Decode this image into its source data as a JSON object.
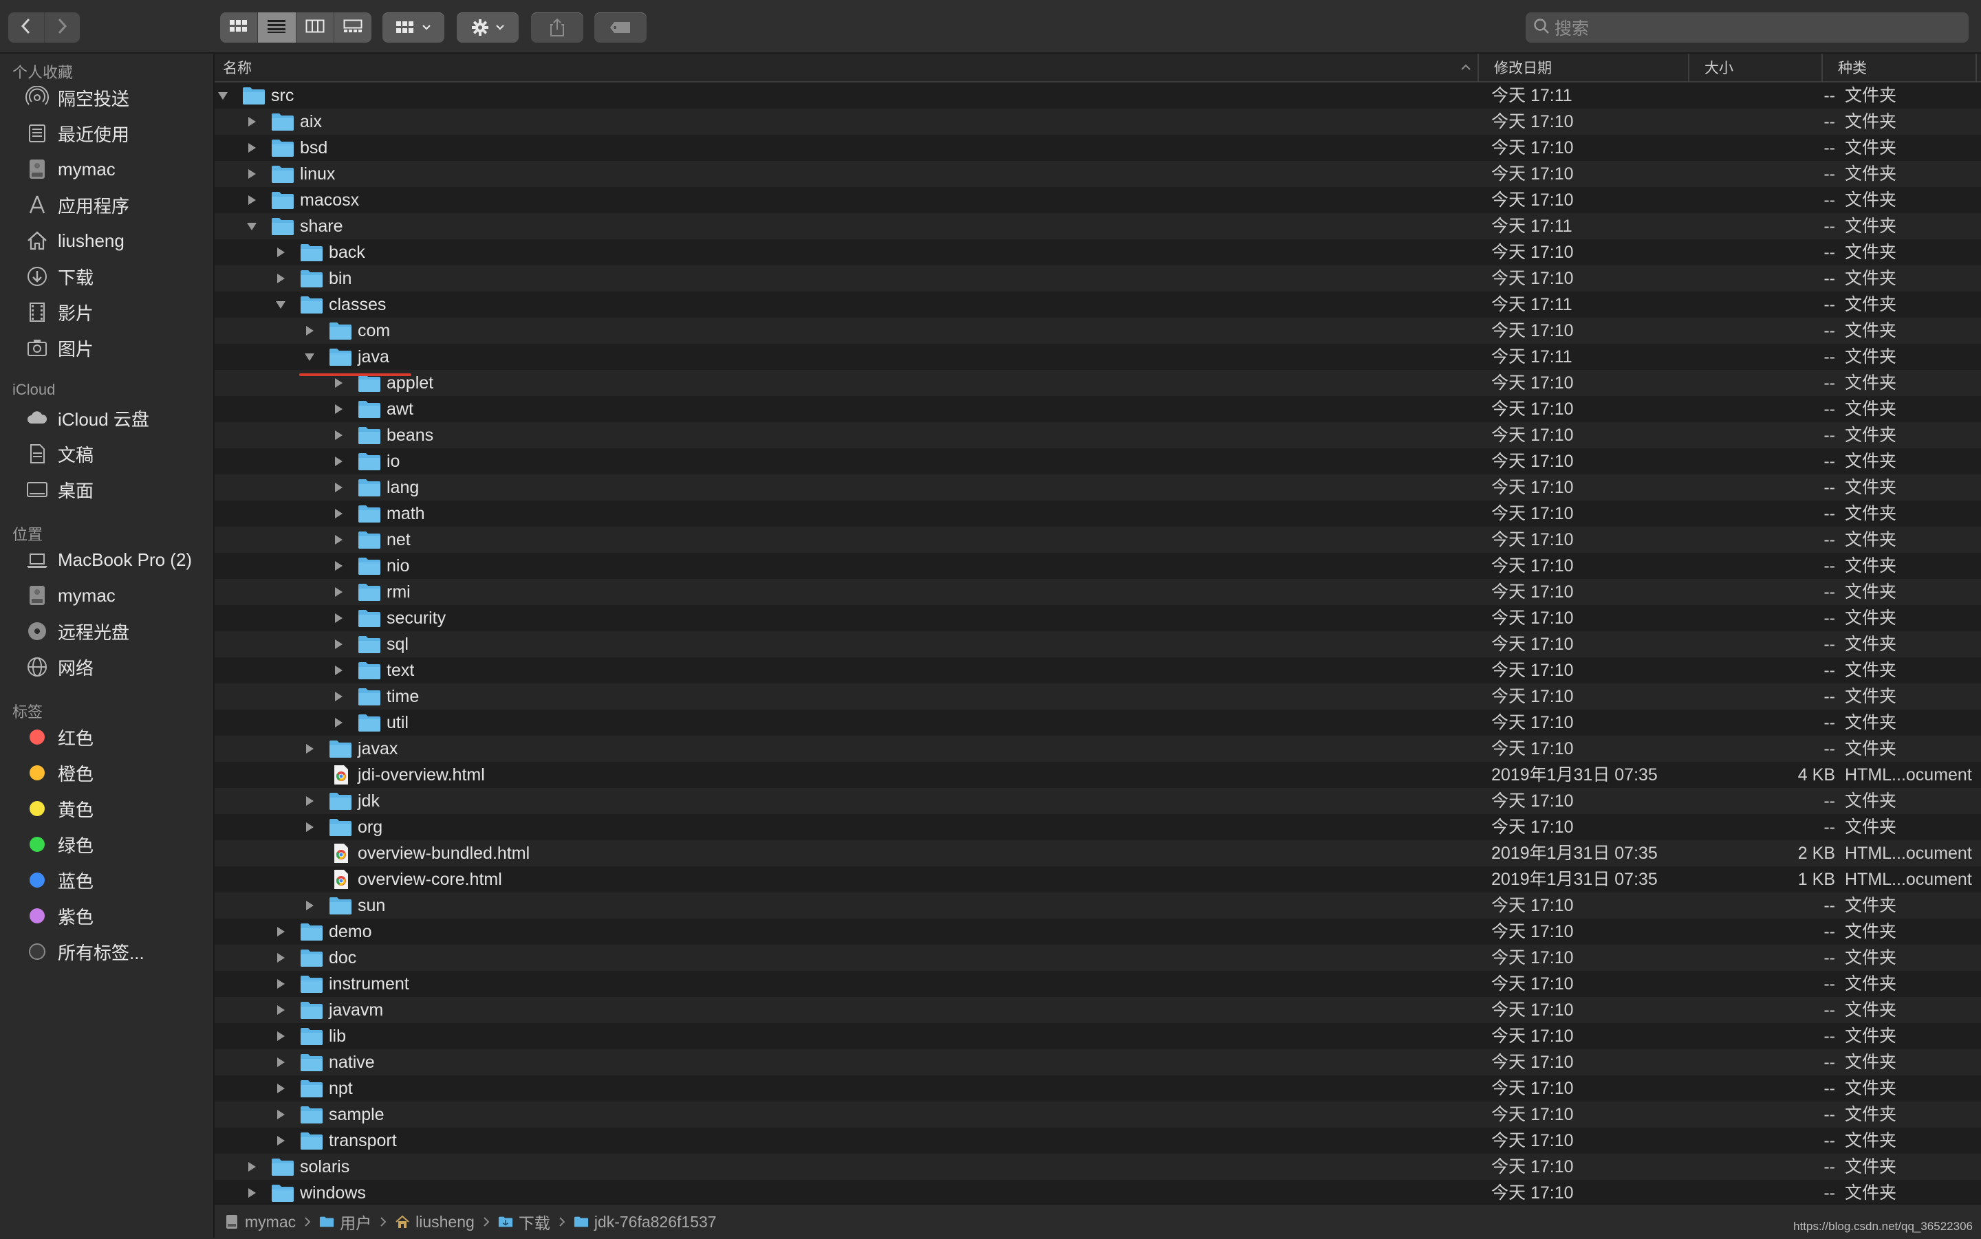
{
  "toolbar": {
    "search_placeholder": "搜索"
  },
  "sidebar": {
    "sections": [
      {
        "header": "个人收藏",
        "items": [
          {
            "label": "隔空投送",
            "icon": "airdrop-icon"
          },
          {
            "label": "最近使用",
            "icon": "recents-icon"
          },
          {
            "label": "mymac",
            "icon": "disk-icon"
          },
          {
            "label": "应用程序",
            "icon": "applications-icon"
          },
          {
            "label": "liusheng",
            "icon": "home-icon"
          },
          {
            "label": "下载",
            "icon": "downloads-icon"
          },
          {
            "label": "影片",
            "icon": "movies-icon"
          },
          {
            "label": "图片",
            "icon": "pictures-icon"
          }
        ]
      },
      {
        "header": "iCloud",
        "items": [
          {
            "label": "iCloud 云盘",
            "icon": "cloud-icon"
          },
          {
            "label": "文稿",
            "icon": "documents-icon"
          },
          {
            "label": "桌面",
            "icon": "desktop-icon"
          }
        ]
      },
      {
        "header": "位置",
        "items": [
          {
            "label": "MacBook Pro (2)",
            "icon": "laptop-icon"
          },
          {
            "label": "mymac",
            "icon": "disk-icon"
          },
          {
            "label": "远程光盘",
            "icon": "disc-icon"
          },
          {
            "label": "网络",
            "icon": "network-icon"
          }
        ]
      },
      {
        "header": "标签",
        "items": [
          {
            "label": "红色",
            "icon": "tag-red-icon",
            "color": "#ff5f57"
          },
          {
            "label": "橙色",
            "icon": "tag-orange-icon",
            "color": "#febc2e"
          },
          {
            "label": "黄色",
            "icon": "tag-yellow-icon",
            "color": "#f7e33c"
          },
          {
            "label": "绿色",
            "icon": "tag-green-icon",
            "color": "#37d84b"
          },
          {
            "label": "蓝色",
            "icon": "tag-blue-icon",
            "color": "#3d8bf7"
          },
          {
            "label": "紫色",
            "icon": "tag-purple-icon",
            "color": "#c87ee8"
          },
          {
            "label": "所有标签...",
            "icon": "all-tags-icon"
          }
        ]
      }
    ]
  },
  "columns": {
    "name": "名称",
    "date": "修改日期",
    "size": "大小",
    "kind": "种类"
  },
  "rows": [
    {
      "name": "src",
      "depth": 0,
      "state": "open",
      "type": "folder",
      "date": "今天 17:11",
      "size": "--",
      "kind": "文件夹"
    },
    {
      "name": "aix",
      "depth": 1,
      "state": "closed",
      "type": "folder",
      "date": "今天 17:10",
      "size": "--",
      "kind": "文件夹"
    },
    {
      "name": "bsd",
      "depth": 1,
      "state": "closed",
      "type": "folder",
      "date": "今天 17:10",
      "size": "--",
      "kind": "文件夹"
    },
    {
      "name": "linux",
      "depth": 1,
      "state": "closed",
      "type": "folder",
      "date": "今天 17:10",
      "size": "--",
      "kind": "文件夹"
    },
    {
      "name": "macosx",
      "depth": 1,
      "state": "closed",
      "type": "folder",
      "date": "今天 17:10",
      "size": "--",
      "kind": "文件夹"
    },
    {
      "name": "share",
      "depth": 1,
      "state": "open",
      "type": "folder",
      "date": "今天 17:11",
      "size": "--",
      "kind": "文件夹"
    },
    {
      "name": "back",
      "depth": 2,
      "state": "closed",
      "type": "folder",
      "date": "今天 17:10",
      "size": "--",
      "kind": "文件夹"
    },
    {
      "name": "bin",
      "depth": 2,
      "state": "closed",
      "type": "folder",
      "date": "今天 17:10",
      "size": "--",
      "kind": "文件夹"
    },
    {
      "name": "classes",
      "depth": 2,
      "state": "open",
      "type": "folder",
      "date": "今天 17:11",
      "size": "--",
      "kind": "文件夹"
    },
    {
      "name": "com",
      "depth": 3,
      "state": "closed",
      "type": "folder",
      "date": "今天 17:10",
      "size": "--",
      "kind": "文件夹"
    },
    {
      "name": "java",
      "depth": 3,
      "state": "open",
      "type": "folder",
      "date": "今天 17:11",
      "size": "--",
      "kind": "文件夹"
    },
    {
      "name": "applet",
      "depth": 4,
      "state": "closed",
      "type": "folder",
      "date": "今天 17:10",
      "size": "--",
      "kind": "文件夹"
    },
    {
      "name": "awt",
      "depth": 4,
      "state": "closed",
      "type": "folder",
      "date": "今天 17:10",
      "size": "--",
      "kind": "文件夹"
    },
    {
      "name": "beans",
      "depth": 4,
      "state": "closed",
      "type": "folder",
      "date": "今天 17:10",
      "size": "--",
      "kind": "文件夹"
    },
    {
      "name": "io",
      "depth": 4,
      "state": "closed",
      "type": "folder",
      "date": "今天 17:10",
      "size": "--",
      "kind": "文件夹"
    },
    {
      "name": "lang",
      "depth": 4,
      "state": "closed",
      "type": "folder",
      "date": "今天 17:10",
      "size": "--",
      "kind": "文件夹"
    },
    {
      "name": "math",
      "depth": 4,
      "state": "closed",
      "type": "folder",
      "date": "今天 17:10",
      "size": "--",
      "kind": "文件夹"
    },
    {
      "name": "net",
      "depth": 4,
      "state": "closed",
      "type": "folder",
      "date": "今天 17:10",
      "size": "--",
      "kind": "文件夹"
    },
    {
      "name": "nio",
      "depth": 4,
      "state": "closed",
      "type": "folder",
      "date": "今天 17:10",
      "size": "--",
      "kind": "文件夹"
    },
    {
      "name": "rmi",
      "depth": 4,
      "state": "closed",
      "type": "folder",
      "date": "今天 17:10",
      "size": "--",
      "kind": "文件夹"
    },
    {
      "name": "security",
      "depth": 4,
      "state": "closed",
      "type": "folder",
      "date": "今天 17:10",
      "size": "--",
      "kind": "文件夹"
    },
    {
      "name": "sql",
      "depth": 4,
      "state": "closed",
      "type": "folder",
      "date": "今天 17:10",
      "size": "--",
      "kind": "文件夹"
    },
    {
      "name": "text",
      "depth": 4,
      "state": "closed",
      "type": "folder",
      "date": "今天 17:10",
      "size": "--",
      "kind": "文件夹"
    },
    {
      "name": "time",
      "depth": 4,
      "state": "closed",
      "type": "folder",
      "date": "今天 17:10",
      "size": "--",
      "kind": "文件夹"
    },
    {
      "name": "util",
      "depth": 4,
      "state": "closed",
      "type": "folder",
      "date": "今天 17:10",
      "size": "--",
      "kind": "文件夹"
    },
    {
      "name": "javax",
      "depth": 3,
      "state": "closed",
      "type": "folder",
      "date": "今天 17:10",
      "size": "--",
      "kind": "文件夹"
    },
    {
      "name": "jdi-overview.html",
      "depth": 3,
      "state": "none",
      "type": "html",
      "date": "2019年1月31日 07:35",
      "size": "4 KB",
      "kind": "HTML...ocument"
    },
    {
      "name": "jdk",
      "depth": 3,
      "state": "closed",
      "type": "folder",
      "date": "今天 17:10",
      "size": "--",
      "kind": "文件夹"
    },
    {
      "name": "org",
      "depth": 3,
      "state": "closed",
      "type": "folder",
      "date": "今天 17:10",
      "size": "--",
      "kind": "文件夹"
    },
    {
      "name": "overview-bundled.html",
      "depth": 3,
      "state": "none",
      "type": "html",
      "date": "2019年1月31日 07:35",
      "size": "2 KB",
      "kind": "HTML...ocument"
    },
    {
      "name": "overview-core.html",
      "depth": 3,
      "state": "none",
      "type": "html",
      "date": "2019年1月31日 07:35",
      "size": "1 KB",
      "kind": "HTML...ocument"
    },
    {
      "name": "sun",
      "depth": 3,
      "state": "closed",
      "type": "folder",
      "date": "今天 17:10",
      "size": "--",
      "kind": "文件夹"
    },
    {
      "name": "demo",
      "depth": 2,
      "state": "closed",
      "type": "folder",
      "date": "今天 17:10",
      "size": "--",
      "kind": "文件夹"
    },
    {
      "name": "doc",
      "depth": 2,
      "state": "closed",
      "type": "folder",
      "date": "今天 17:10",
      "size": "--",
      "kind": "文件夹"
    },
    {
      "name": "instrument",
      "depth": 2,
      "state": "closed",
      "type": "folder",
      "date": "今天 17:10",
      "size": "--",
      "kind": "文件夹"
    },
    {
      "name": "javavm",
      "depth": 2,
      "state": "closed",
      "type": "folder",
      "date": "今天 17:10",
      "size": "--",
      "kind": "文件夹"
    },
    {
      "name": "lib",
      "depth": 2,
      "state": "closed",
      "type": "folder",
      "date": "今天 17:10",
      "size": "--",
      "kind": "文件夹"
    },
    {
      "name": "native",
      "depth": 2,
      "state": "closed",
      "type": "folder",
      "date": "今天 17:10",
      "size": "--",
      "kind": "文件夹"
    },
    {
      "name": "npt",
      "depth": 2,
      "state": "closed",
      "type": "folder",
      "date": "今天 17:10",
      "size": "--",
      "kind": "文件夹"
    },
    {
      "name": "sample",
      "depth": 2,
      "state": "closed",
      "type": "folder",
      "date": "今天 17:10",
      "size": "--",
      "kind": "文件夹"
    },
    {
      "name": "transport",
      "depth": 2,
      "state": "closed",
      "type": "folder",
      "date": "今天 17:10",
      "size": "--",
      "kind": "文件夹"
    },
    {
      "name": "solaris",
      "depth": 1,
      "state": "closed",
      "type": "folder",
      "date": "今天 17:10",
      "size": "--",
      "kind": "文件夹"
    },
    {
      "name": "windows",
      "depth": 1,
      "state": "closed",
      "type": "folder",
      "date": "今天 17:10",
      "size": "--",
      "kind": "文件夹"
    }
  ],
  "pathbar": [
    {
      "label": "mymac",
      "icon": "disk-icon"
    },
    {
      "label": "用户",
      "icon": "folder-icon"
    },
    {
      "label": "liusheng",
      "icon": "home-icon"
    },
    {
      "label": "下载",
      "icon": "downloads-folder-icon"
    },
    {
      "label": "jdk-76fa826f1537",
      "icon": "folder-icon"
    }
  ],
  "watermark": "https://blog.csdn.net/qq_36522306",
  "colors": {
    "folder": "#5cb4e6",
    "highlight_underline": "#d83a2e"
  }
}
